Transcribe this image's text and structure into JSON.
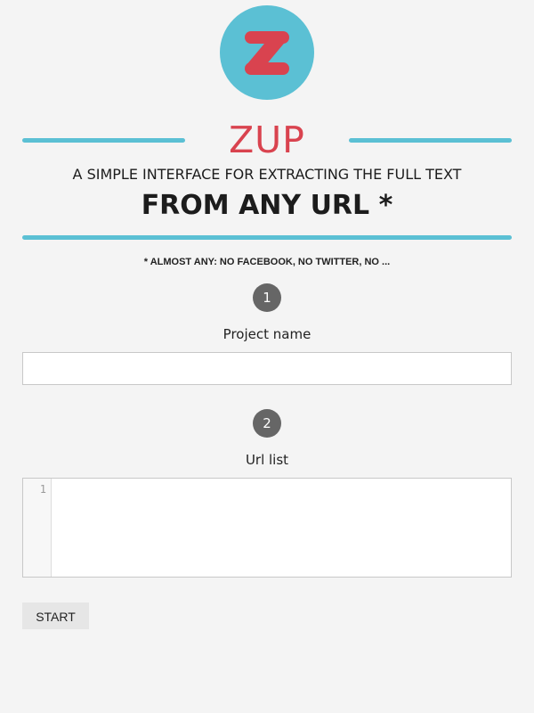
{
  "header": {
    "logo_icon": "zup-z-logo-icon",
    "brand_name": "ZUP",
    "tagline_line1": "A SIMPLE INTERFACE FOR EXTRACTING THE FULL TEXT",
    "tagline_line2": "FROM ANY URL *",
    "footnote": "* ALMOST ANY: NO FACEBOOK, NO TWITTER, NO ..."
  },
  "form": {
    "step1": {
      "number": "1",
      "label": "Project name",
      "value": "",
      "placeholder": ""
    },
    "step2": {
      "number": "2",
      "label": "Url list",
      "line_numbers": [
        "1"
      ],
      "value": ""
    },
    "start_label": "START"
  },
  "colors": {
    "accent": "#5bc0d4",
    "brand": "#d9434f",
    "step_badge": "#666666",
    "background": "#f4f4f4"
  }
}
